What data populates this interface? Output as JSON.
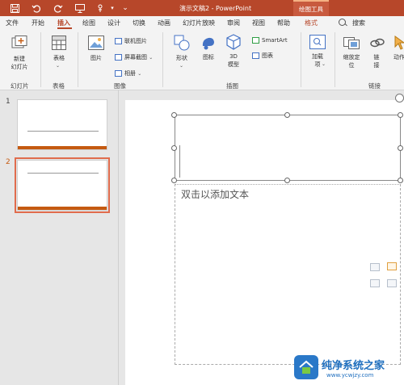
{
  "window": {
    "title": "演示文稿2 - PowerPoint",
    "context_tool_title": "绘图工具"
  },
  "ribbon_tabs": [
    "文件",
    "开始",
    "插入",
    "绘图",
    "设计",
    "切换",
    "动画",
    "幻灯片放映",
    "审阅",
    "视图",
    "帮助",
    "格式"
  ],
  "active_tab": "插入",
  "search": {
    "label": "搜索"
  },
  "groups": {
    "slides": {
      "label": "幻灯片",
      "new_slide_label": "新建\n幻灯片"
    },
    "tables": {
      "label": "表格",
      "table_label": "表格"
    },
    "images": {
      "label": "图像",
      "picture_label": "图片",
      "online_pictures": "联机图片",
      "screenshot": "屏幕截图",
      "album": "相册"
    },
    "illustrations": {
      "label": "插图",
      "shapes_label": "形状",
      "icons_label": "图标",
      "model3d_label": "3D\n模型",
      "smartart": "SmartArt",
      "chart": "图表"
    },
    "addins": {
      "label": "加载项",
      "addins_label": "加载\n项"
    },
    "links": {
      "label": "链接",
      "zoom_label": "缩放定\n位",
      "link_label": "链\n接",
      "action_label": "动作"
    }
  },
  "slides": [
    {
      "number": "1",
      "selected": false
    },
    {
      "number": "2",
      "selected": true
    }
  ],
  "slide_body": {
    "placeholder": "双击以添加文本"
  },
  "watermark": {
    "title": "纯净系统之家",
    "url": "www.ycwjzy.com"
  },
  "colors": {
    "accent": "#b7472a",
    "selection": "#e06c4d",
    "thumb_bar": "#c55a11"
  }
}
